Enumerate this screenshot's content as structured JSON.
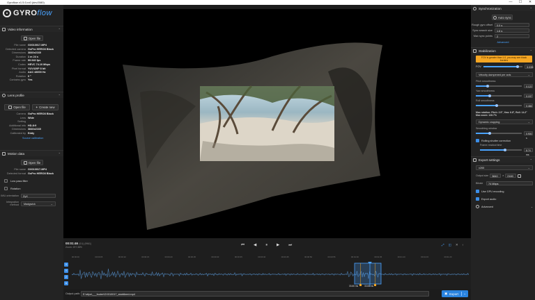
{
  "window": {
    "title": "Gyroflow v1.5.0-rc0 (dev2080)",
    "controls": [
      "—",
      "☐",
      "✕"
    ]
  },
  "app": {
    "logo_word": "GYRO",
    "logo_script": "flow"
  },
  "video_info": {
    "title": "Video information",
    "open_file": "Open file",
    "rows": [
      {
        "k": "File name",
        "v": "GX010017.MP4"
      },
      {
        "k": "Detected camera",
        "v": "GoPro HERO8 Black"
      },
      {
        "k": "Dimensions",
        "v": "3840x2160"
      },
      {
        "k": "Duration",
        "v": "1 m 24 s"
      },
      {
        "k": "Frame rate",
        "v": "59.940 fps"
      },
      {
        "k": "Codec",
        "v": "HEVC 74.10 Mbps"
      },
      {
        "k": "Pixel format",
        "v": "YUV420P 8 bit"
      },
      {
        "k": "Audio",
        "v": "AAC 48000 Hz"
      },
      {
        "k": "Rotation",
        "v": "0 °"
      },
      {
        "k": "Contains gyro",
        "v": "Yes"
      }
    ]
  },
  "lens_profile": {
    "title": "Lens profile",
    "open_file": "Open file",
    "create_new": "Create new",
    "rows": [
      {
        "k": "Camera",
        "v": "GoPro HERO8 Black"
      },
      {
        "k": "Lens",
        "v": "Wide"
      },
      {
        "k": "Setting",
        "v": ""
      },
      {
        "k": "Additional info",
        "v": "HD-8:9"
      },
      {
        "k": "Dimensions",
        "v": "3840x2160"
      },
      {
        "k": "Calibrated by",
        "v": "Eddy"
      }
    ],
    "link": "Source calibration"
  },
  "motion_data": {
    "title": "Motion data",
    "open_file": "Open file",
    "rows": [
      {
        "k": "File name",
        "v": "GX010017.MP4"
      },
      {
        "k": "Detected format",
        "v": "GoPro HERO8 Black"
      }
    ],
    "low_pass": "Low pass filter",
    "rotation": "Rotation",
    "imu_label": "IMU orientation",
    "imu_value": "ZyX",
    "integration_label": "Integration method",
    "integration_value": "Madgwick"
  },
  "sync": {
    "title": "Synchronization",
    "auto_sync": "Auto sync",
    "rows": [
      {
        "k": "Rough gyro offset",
        "v": "0.0 s"
      },
      {
        "k": "Sync search size",
        "v": "1.6 s"
      },
      {
        "k": "Max sync points",
        "v": "2"
      }
    ],
    "advanced": "Advanced"
  },
  "stabilization": {
    "title": "Stabilization",
    "warning": "FOV is greater than 1.0, you may see black borders",
    "fov_label": "FOV",
    "fov_value": "3.035",
    "fov_fraction": 0.88,
    "method": "Velocity dampened per axis",
    "pitch_label": "Pitch smoothness",
    "pitch_value": "0.122",
    "pitch_fraction": 0.25,
    "yaw_label": "Yaw smoothness",
    "yaw_value": "0.157",
    "yaw_fraction": 0.3,
    "roll_label": "Roll smoothness",
    "roll_value": "0.466",
    "roll_fraction": 0.45,
    "max_rotation": "Max rotation: Pitch: 2.5°, Yaw: 6.8°, Roll: 14.2°",
    "max_zoom": "Max zoom: 126.7%",
    "cropping": "Dynamic cropping",
    "smoothing_label": "Smoothing window",
    "smoothing_value": "0.900 s",
    "smoothing_fraction": 0.3,
    "rolling_shutter": "Rolling shutter correction",
    "frame_readout_label": "Frame readout time",
    "frame_readout_value": "8.74 ms",
    "frame_readout_fraction": 0.6
  },
  "export": {
    "title": "Export settings",
    "codec": "x265",
    "output_size_label": "Output size",
    "width": "3840",
    "height": "2160",
    "bitrate_label": "Bitrate",
    "bitrate_value": "74 Mbps",
    "gpu_encoding": "Use GPU encoding",
    "export_audio": "Export audio",
    "advanced": "Advanced"
  },
  "timeline": {
    "time": "00:01:46",
    "frames": "(0/1)   (9961)",
    "zoom": "Zoom: 197.38%",
    "controls": [
      "⏮",
      "◀",
      "⏸",
      "▶",
      "⏭"
    ],
    "ticks": [
      "00:00:00",
      "00:00:05",
      "00:00:10",
      "00:00:15",
      "00:00:20",
      "00:00:25",
      "00:00:30",
      "00:00:35",
      "00:00:40",
      "00:00:45",
      "00:00:50",
      "00:00:55",
      "00:01:00",
      "00:01:05",
      "00:01:10",
      "00:01:15",
      "00:01:20"
    ],
    "lanes": [
      "X",
      "Y",
      "Z",
      "A"
    ],
    "sync_points": [
      "33.66 ms",
      "33.66 ms"
    ]
  },
  "bottom": {
    "output_label": "Output path:",
    "output_path": "E:\\clips\\___footer\\GX010017_stabilized.mp4",
    "export_button": "Export"
  },
  "colors": {
    "accent": "#4aa3ff",
    "warning": "#f5a623",
    "selection": "#4aa3ff"
  }
}
